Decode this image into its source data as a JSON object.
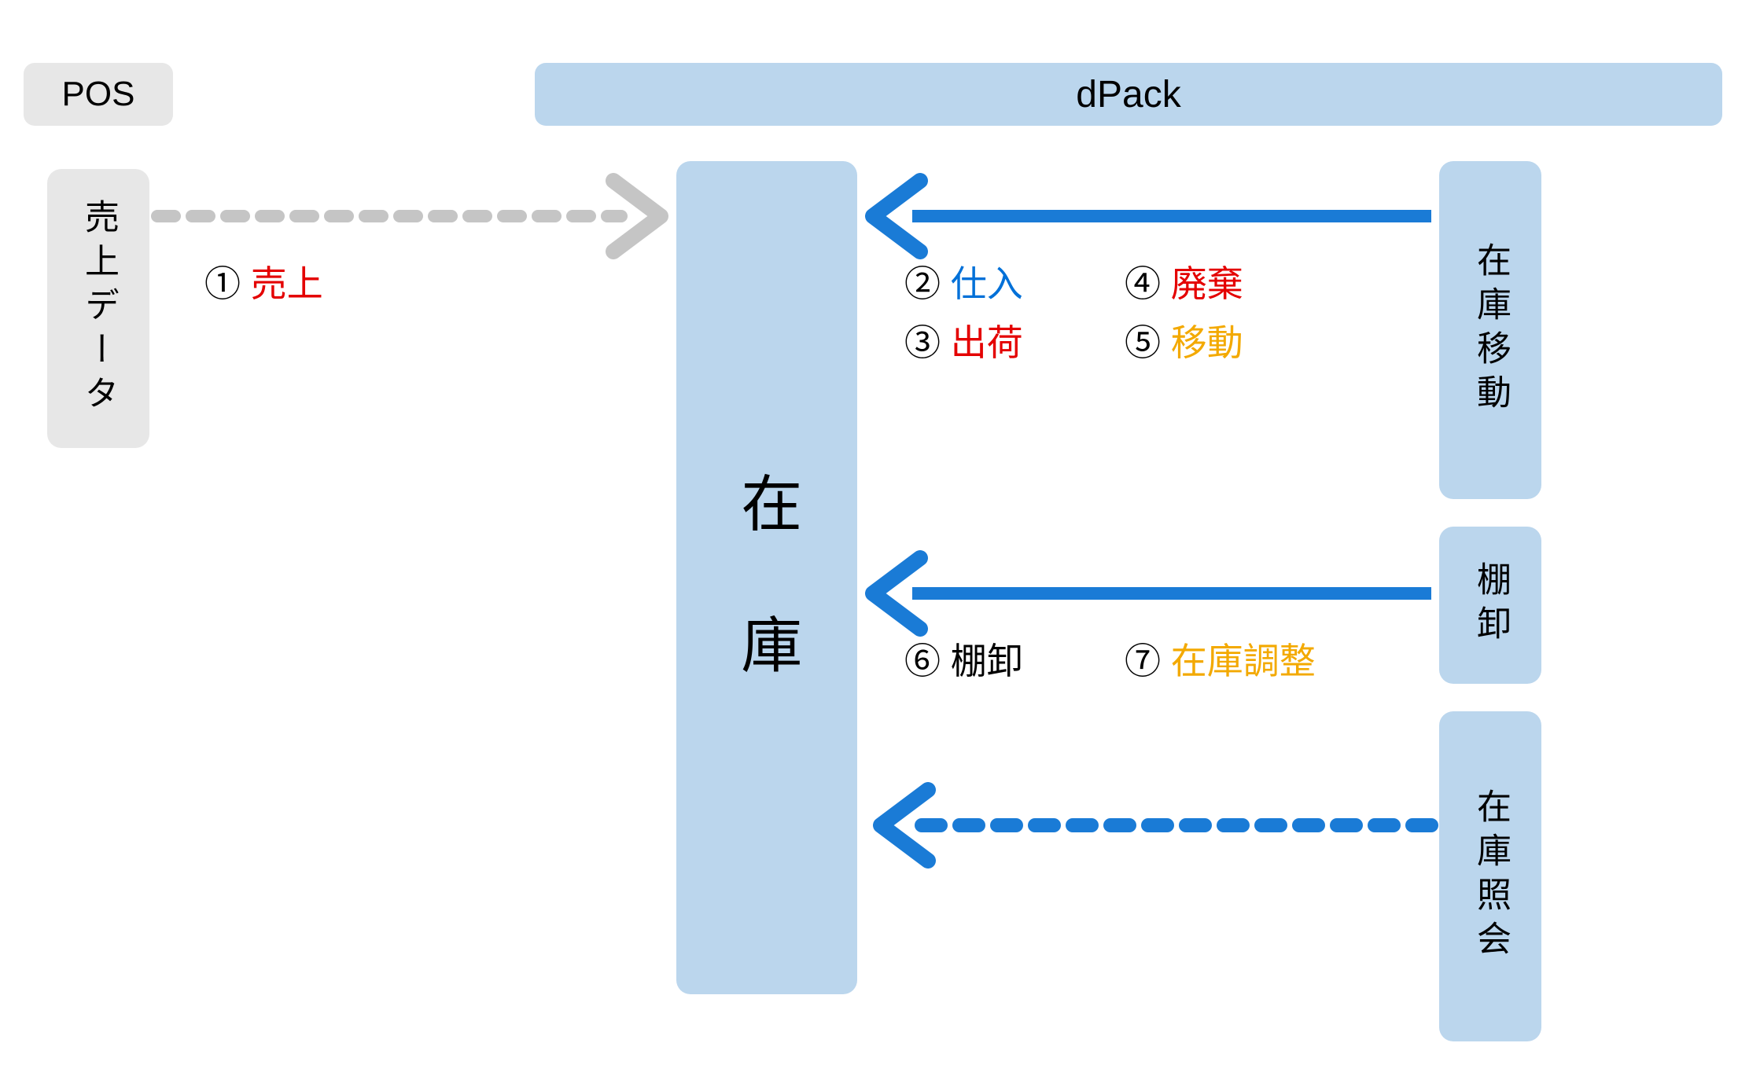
{
  "header": {
    "pos": "POS",
    "dpack": "dPack"
  },
  "boxes": {
    "sales_data": "売上データ",
    "zaiko": "在　庫",
    "zaiko_move": "在庫移動",
    "tanaoroshi": "棚卸",
    "zaiko_query": "在庫照会"
  },
  "labels": {
    "n1": "①",
    "t1": "売上",
    "n2": "②",
    "t2": "仕入",
    "n3": "③",
    "t3": "出荷",
    "n4": "④",
    "t4": "廃棄",
    "n5": "⑤",
    "t5": "移動",
    "n6": "⑥",
    "t6": "棚卸",
    "n7": "⑦",
    "t7": "在庫調整"
  },
  "colors": {
    "grey": "#e7e7e7",
    "blue_box": "#bbd6ed",
    "arrow_blue": "#1a7bd6",
    "arrow_grey": "#c5c5c5",
    "red": "#e40000",
    "label_blue": "#0070d8",
    "gold": "#f3a900"
  },
  "arrows": [
    {
      "from": "sales_data",
      "to": "zaiko",
      "style": "dotted",
      "color": "grey"
    },
    {
      "from": "zaiko_move",
      "to": "zaiko",
      "style": "solid",
      "color": "blue"
    },
    {
      "from": "tanaoroshi",
      "to": "zaiko",
      "style": "solid",
      "color": "blue"
    },
    {
      "from": "zaiko_query",
      "to": "zaiko",
      "style": "dotted",
      "color": "blue"
    }
  ]
}
